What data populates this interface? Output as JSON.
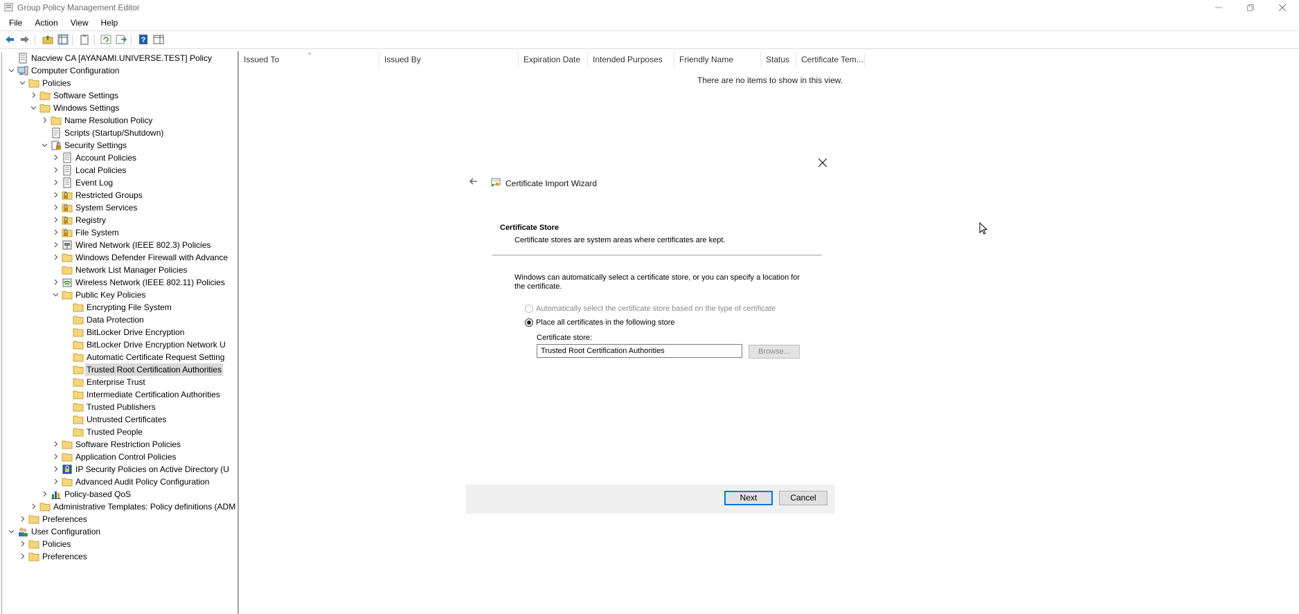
{
  "window": {
    "title": "Group Policy Management Editor",
    "controls": [
      "minimize",
      "restore",
      "close"
    ]
  },
  "menu": [
    "File",
    "Action",
    "View",
    "Help"
  ],
  "toolbar": [
    "back-arrow-icon",
    "forward-arrow-icon",
    "up-folder-icon",
    "show-hide-tree-icon",
    "properties-icon",
    "refresh-icon",
    "export-list-icon",
    "help-icon",
    "show-hide-action-pane-icon"
  ],
  "tree": [
    {
      "label": "Nacview CA [AYANAMI.UNIVERSE.TEST] Policy",
      "level": 0,
      "expander": "none",
      "icon": "policy-icon"
    },
    {
      "label": "Computer Configuration",
      "level": 0,
      "expander": "open",
      "icon": "computer-icon"
    },
    {
      "label": "Policies",
      "level": 1,
      "expander": "open",
      "icon": "folder-icon"
    },
    {
      "label": "Software Settings",
      "level": 2,
      "expander": "closed",
      "icon": "folder-icon"
    },
    {
      "label": "Windows Settings",
      "level": 2,
      "expander": "open",
      "icon": "folder-icon"
    },
    {
      "label": "Name Resolution Policy",
      "level": 3,
      "expander": "closed",
      "icon": "folder-icon"
    },
    {
      "label": "Scripts (Startup/Shutdown)",
      "level": 3,
      "expander": "none",
      "icon": "script-icon"
    },
    {
      "label": "Security Settings",
      "level": 3,
      "expander": "open",
      "icon": "security-icon"
    },
    {
      "label": "Account Policies",
      "level": 4,
      "expander": "closed",
      "icon": "policy-icon"
    },
    {
      "label": "Local Policies",
      "level": 4,
      "expander": "closed",
      "icon": "policy-icon"
    },
    {
      "label": "Event Log",
      "level": 4,
      "expander": "closed",
      "icon": "policy-icon"
    },
    {
      "label": "Restricted Groups",
      "level": 4,
      "expander": "closed",
      "icon": "locked-folder-icon"
    },
    {
      "label": "System Services",
      "level": 4,
      "expander": "closed",
      "icon": "locked-folder-icon"
    },
    {
      "label": "Registry",
      "level": 4,
      "expander": "closed",
      "icon": "locked-folder-icon"
    },
    {
      "label": "File System",
      "level": 4,
      "expander": "closed",
      "icon": "locked-folder-icon"
    },
    {
      "label": "Wired Network (IEEE 802.3) Policies",
      "level": 4,
      "expander": "closed",
      "icon": "network-icon"
    },
    {
      "label": "Windows Defender Firewall with Advance",
      "level": 4,
      "expander": "closed",
      "icon": "folder-icon"
    },
    {
      "label": "Network List Manager Policies",
      "level": 4,
      "expander": "none",
      "icon": "folder-icon"
    },
    {
      "label": "Wireless Network (IEEE 802.11) Policies",
      "level": 4,
      "expander": "closed",
      "icon": "wireless-icon"
    },
    {
      "label": "Public Key Policies",
      "level": 4,
      "expander": "open",
      "icon": "folder-icon"
    },
    {
      "label": "Encrypting File System",
      "level": 5,
      "expander": "none",
      "icon": "folder-icon"
    },
    {
      "label": "Data Protection",
      "level": 5,
      "expander": "none",
      "icon": "folder-icon"
    },
    {
      "label": "BitLocker Drive Encryption",
      "level": 5,
      "expander": "none",
      "icon": "folder-icon"
    },
    {
      "label": "BitLocker Drive Encryption Network U",
      "level": 5,
      "expander": "none",
      "icon": "folder-icon"
    },
    {
      "label": "Automatic Certificate Request Setting",
      "level": 5,
      "expander": "none",
      "icon": "folder-icon"
    },
    {
      "label": "Trusted Root Certification Authorities",
      "level": 5,
      "expander": "none",
      "icon": "folder-icon",
      "selected": true
    },
    {
      "label": "Enterprise Trust",
      "level": 5,
      "expander": "none",
      "icon": "folder-icon"
    },
    {
      "label": "Intermediate Certification Authorities",
      "level": 5,
      "expander": "none",
      "icon": "folder-icon"
    },
    {
      "label": "Trusted Publishers",
      "level": 5,
      "expander": "none",
      "icon": "folder-icon"
    },
    {
      "label": "Untrusted Certificates",
      "level": 5,
      "expander": "none",
      "icon": "folder-icon"
    },
    {
      "label": "Trusted People",
      "level": 5,
      "expander": "none",
      "icon": "folder-icon"
    },
    {
      "label": "Software Restriction Policies",
      "level": 4,
      "expander": "closed",
      "icon": "folder-icon"
    },
    {
      "label": "Application Control Policies",
      "level": 4,
      "expander": "closed",
      "icon": "folder-icon"
    },
    {
      "label": "IP Security Policies on Active Directory (U",
      "level": 4,
      "expander": "closed",
      "icon": "ipsec-icon"
    },
    {
      "label": "Advanced Audit Policy Configuration",
      "level": 4,
      "expander": "closed",
      "icon": "folder-icon"
    },
    {
      "label": "Policy-based QoS",
      "level": 3,
      "expander": "closed",
      "icon": "chart-icon"
    },
    {
      "label": "Administrative Templates: Policy definitions (ADM",
      "level": 2,
      "expander": "closed",
      "icon": "folder-icon"
    },
    {
      "label": "Preferences",
      "level": 1,
      "expander": "closed",
      "icon": "folder-icon"
    },
    {
      "label": "User Configuration",
      "level": 0,
      "expander": "open",
      "icon": "users-icon"
    },
    {
      "label": "Policies",
      "level": 1,
      "expander": "closed",
      "icon": "folder-icon"
    },
    {
      "label": "Preferences",
      "level": 1,
      "expander": "closed",
      "icon": "folder-icon"
    }
  ],
  "list": {
    "columns": [
      "Issued To",
      "Issued By",
      "Expiration Date",
      "Intended Purposes",
      "Friendly Name",
      "Status",
      "Certificate Tem..."
    ],
    "empty_message": "There are no items to show in this view."
  },
  "wizard": {
    "title": "Certificate Import Wizard",
    "heading": "Certificate Store",
    "subheading": "Certificate stores are system areas where certificates are kept.",
    "description": "Windows can automatically select a certificate store, or you can specify a location for the certificate.",
    "option_auto": "Automatically select the certificate store based on the type of certificate",
    "option_manual": "Place all certificates in the following store",
    "selected_option": "manual",
    "store_label": "Certificate store:",
    "store_value": "Trusted Root Certification Authorities",
    "browse_label": "Browse...",
    "next_label": "Next",
    "cancel_label": "Cancel"
  }
}
